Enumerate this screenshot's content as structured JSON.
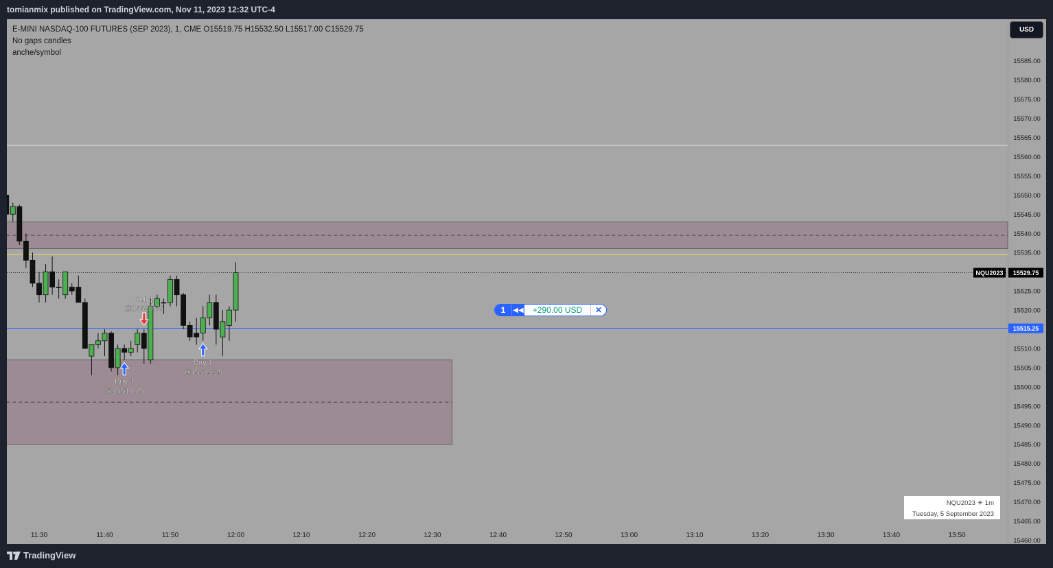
{
  "publish_line": "tomianmix published on TradingView.com, Nov 11, 2023 12:32 UTC-4",
  "brand": "TradingView",
  "currency_button": "USD",
  "header": {
    "symbol_line": "E-MINI NASDAQ-100 FUTURES (SEP 2023), 1, CME  O15519.75  H15532.50  L15517.00  C15529.75",
    "indicator_1": "No gaps candles",
    "indicator_2": "anche/symbol"
  },
  "position": {
    "qty": "1",
    "reverse_icon": "reverse-icon",
    "pnl": "+290.00 USD",
    "close_icon": "close-icon"
  },
  "info_box": {
    "line1": "NQU2023 ☀ 1m",
    "line2": "Tuesday, 5 September 2023"
  },
  "colors": {
    "background": "#a6a6a6",
    "up": "#4caf50",
    "down": "#111111",
    "zone": "#8a5a6e",
    "position_line": "#2962ff",
    "sell": "#e53935",
    "buy": "#2962ff",
    "yellow_line": "#f0e040"
  },
  "chart_data": {
    "type": "candlestick",
    "title": "E-MINI NASDAQ-100 FUTURES (SEP 2023), 1, CME",
    "ylim": [
      15457,
      15588
    ],
    "y_ticks": [
      15585,
      15580,
      15575,
      15570,
      15565,
      15560,
      15555,
      15550,
      15545,
      15540,
      15535,
      15530,
      15525,
      15520,
      15515,
      15510,
      15505,
      15500,
      15495,
      15490,
      15485,
      15480,
      15475,
      15470,
      15465,
      15460
    ],
    "y_tick_labels": [
      "15585.00",
      "15580.00",
      "15575.00",
      "15570.00",
      "15565.00",
      "15560.00",
      "15555.00",
      "15550.00",
      "15545.00",
      "15540.00",
      "15535.00",
      "15530.00",
      "15525.00",
      "15520.00",
      "15515.00",
      "15510.00",
      "15505.00",
      "15500.00",
      "15495.00",
      "15490.00",
      "15485.00",
      "15480.00",
      "15475.00",
      "15470.00",
      "15465.00",
      "15460.00"
    ],
    "x_ticks": [
      "11:30",
      "11:40",
      "11:50",
      "12:00",
      "12:10",
      "12:20",
      "12:30",
      "12:40",
      "12:50",
      "13:00",
      "13:10",
      "13:20",
      "13:30",
      "13:40",
      "13:50"
    ],
    "first_bar_time": "11:25",
    "candles": [
      {
        "o": 15550.0,
        "h": 15551.0,
        "l": 15544.0,
        "c": 15545.0
      },
      {
        "o": 15545.0,
        "h": 15548.0,
        "l": 15543.0,
        "c": 15547.0
      },
      {
        "o": 15547.0,
        "h": 15547.5,
        "l": 15537.0,
        "c": 15538.0
      },
      {
        "o": 15538.0,
        "h": 15540.0,
        "l": 15531.0,
        "c": 15533.0
      },
      {
        "o": 15533.0,
        "h": 15535.0,
        "l": 15526.0,
        "c": 15527.0
      },
      {
        "o": 15527.0,
        "h": 15530.0,
        "l": 15522.0,
        "c": 15524.0
      },
      {
        "o": 15524.0,
        "h": 15532.0,
        "l": 15522.0,
        "c": 15530.0
      },
      {
        "o": 15530.0,
        "h": 15534.0,
        "l": 15524.0,
        "c": 15526.0
      },
      {
        "o": 15526.0,
        "h": 15528.0,
        "l": 15523.0,
        "c": 15526.0
      },
      {
        "o": 15524.0,
        "h": 15530.0,
        "l": 15523.0,
        "c": 15530.0
      },
      {
        "o": 15526.0,
        "h": 15527.0,
        "l": 15524.0,
        "c": 15525.0
      },
      {
        "o": 15526.0,
        "h": 15529.0,
        "l": 15522.0,
        "c": 15522.0
      },
      {
        "o": 15522.0,
        "h": 15523.0,
        "l": 15510.0,
        "c": 15510.0
      },
      {
        "o": 15508.0,
        "h": 15511.0,
        "l": 15503.0,
        "c": 15511.0
      },
      {
        "o": 15511.0,
        "h": 15514.0,
        "l": 15510.0,
        "c": 15512.0
      },
      {
        "o": 15512.0,
        "h": 15515.0,
        "l": 15508.0,
        "c": 15514.0
      },
      {
        "o": 15514.0,
        "h": 15514.5,
        "l": 15504.0,
        "c": 15505.0
      },
      {
        "o": 15505.0,
        "h": 15511.0,
        "l": 15503.0,
        "c": 15510.0
      },
      {
        "o": 15510.0,
        "h": 15511.0,
        "l": 15507.0,
        "c": 15509.0
      },
      {
        "o": 15509.0,
        "h": 15512.0,
        "l": 15508.0,
        "c": 15510.0
      },
      {
        "o": 15511.0,
        "h": 15515.0,
        "l": 15509.0,
        "c": 15514.0
      },
      {
        "o": 15514.0,
        "h": 15515.0,
        "l": 15506.0,
        "c": 15510.0
      },
      {
        "o": 15507.0,
        "h": 15523.0,
        "l": 15506.0,
        "c": 15521.0
      },
      {
        "o": 15521.0,
        "h": 15524.0,
        "l": 15520.0,
        "c": 15523.0
      },
      {
        "o": 15522.0,
        "h": 15523.0,
        "l": 15519.0,
        "c": 15522.0
      },
      {
        "o": 15522.0,
        "h": 15529.0,
        "l": 15521.0,
        "c": 15528.0
      },
      {
        "o": 15528.0,
        "h": 15529.0,
        "l": 15521.0,
        "c": 15524.0
      },
      {
        "o": 15524.0,
        "h": 15524.5,
        "l": 15515.0,
        "c": 15516.0
      },
      {
        "o": 15516.0,
        "h": 15517.0,
        "l": 15512.0,
        "c": 15513.0
      },
      {
        "o": 15514.0,
        "h": 15518.0,
        "l": 15511.0,
        "c": 15513.0
      },
      {
        "o": 15514.0,
        "h": 15521.0,
        "l": 15512.0,
        "c": 15518.0
      },
      {
        "o": 15518.0,
        "h": 15524.0,
        "l": 15516.0,
        "c": 15522.0
      },
      {
        "o": 15522.0,
        "h": 15524.0,
        "l": 15511.0,
        "c": 15515.0
      },
      {
        "o": 15513.0,
        "h": 15520.0,
        "l": 15508.0,
        "c": 15517.0
      },
      {
        "o": 15516.0,
        "h": 15521.0,
        "l": 15512.0,
        "c": 15520.0
      },
      {
        "o": 15520.0,
        "h": 15532.5,
        "l": 15517.0,
        "c": 15529.75
      }
    ],
    "horizontal_lines": [
      {
        "price": 15563.0,
        "color": "#e8e8e8",
        "style": "solid"
      },
      {
        "price": 15534.5,
        "color": "#f0e040",
        "style": "solid"
      },
      {
        "price": 15529.75,
        "color": "#222222",
        "style": "dotted"
      },
      {
        "price": 15515.25,
        "color": "#2962ff",
        "style": "solid"
      }
    ],
    "zones": [
      {
        "top": 15543.0,
        "bottom": 15536.0,
        "mid": 15539.5,
        "from_time": "11:25",
        "to_time": "axis"
      },
      {
        "top": 15507.0,
        "bottom": 15485.0,
        "mid": 15496.0,
        "from_time": "11:25",
        "to_time": "12:33"
      }
    ],
    "price_labels": [
      {
        "text": "NQU2023",
        "price": 15529.75
      },
      {
        "text": "15529.75",
        "price": 15529.75
      },
      {
        "text": "15515.25",
        "price": 15515.25
      }
    ],
    "trades": [
      {
        "side": "sell",
        "bar": 21,
        "label": "Sell 1",
        "price_text": "@15520.75"
      },
      {
        "side": "buy",
        "bar": 18,
        "label": "Buy 1",
        "price_text": "@15510.75"
      },
      {
        "side": "buy",
        "bar": 30,
        "label": "Buy 1",
        "price_text": "@15515.25"
      }
    ]
  }
}
